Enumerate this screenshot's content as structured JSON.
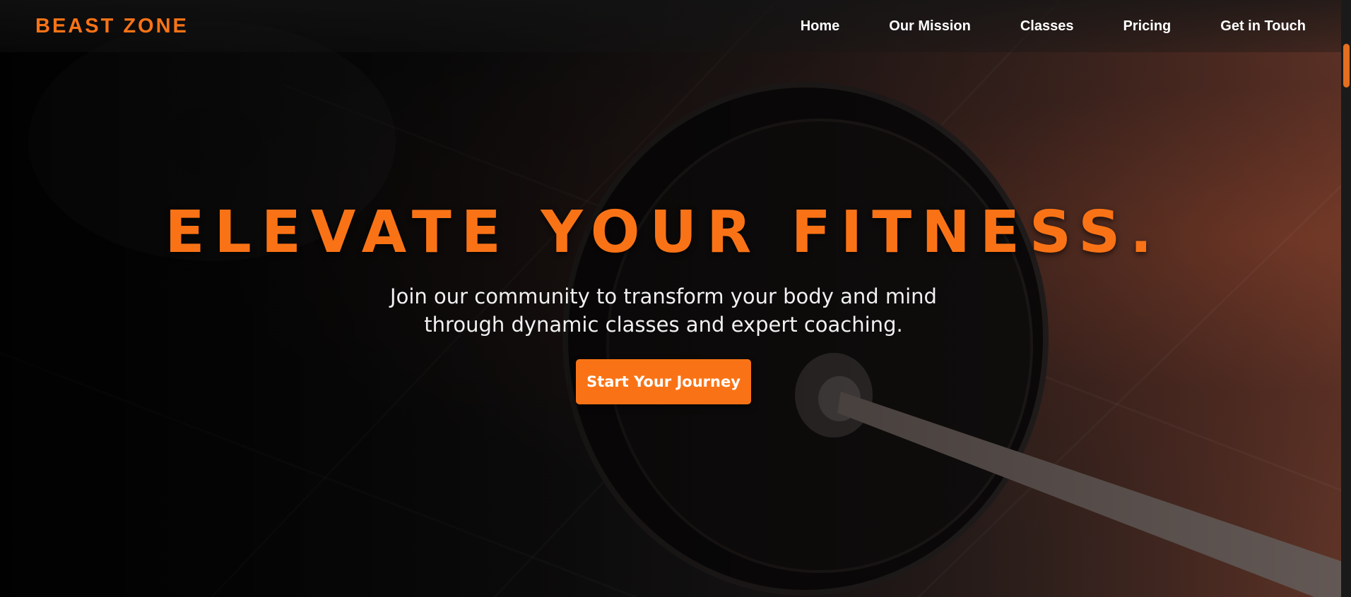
{
  "brand": {
    "name": "BEAST ZONE",
    "accent_color": "#f97316"
  },
  "nav": {
    "items": [
      {
        "label": "Home"
      },
      {
        "label": "Our Mission"
      },
      {
        "label": "Classes"
      },
      {
        "label": "Pricing"
      },
      {
        "label": "Get in Touch"
      }
    ]
  },
  "hero": {
    "title": "ELEVATE YOUR FITNESS.",
    "subtitle": "Join our community to transform your body and mind through dynamic classes and expert coaching.",
    "cta_label": "Start Your Journey",
    "background_image": "barbell-weight-plate-photo"
  }
}
